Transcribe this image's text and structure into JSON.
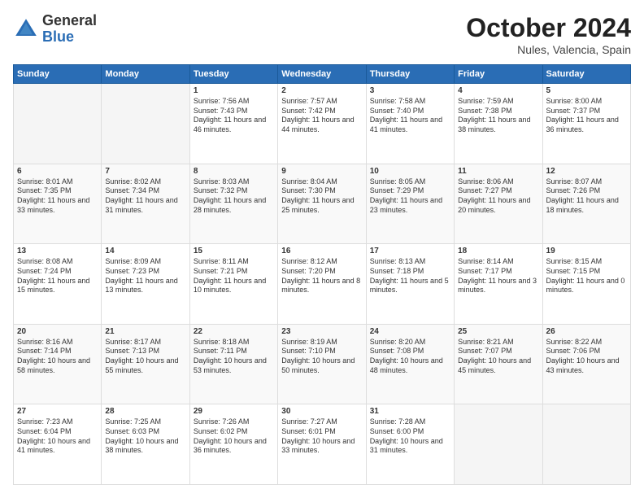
{
  "header": {
    "logo_general": "General",
    "logo_blue": "Blue",
    "month_year": "October 2024",
    "location": "Nules, Valencia, Spain"
  },
  "days_of_week": [
    "Sunday",
    "Monday",
    "Tuesday",
    "Wednesday",
    "Thursday",
    "Friday",
    "Saturday"
  ],
  "weeks": [
    [
      {
        "day": "",
        "sunrise": "",
        "sunset": "",
        "daylight": ""
      },
      {
        "day": "",
        "sunrise": "",
        "sunset": "",
        "daylight": ""
      },
      {
        "day": "1",
        "sunrise": "Sunrise: 7:56 AM",
        "sunset": "Sunset: 7:43 PM",
        "daylight": "Daylight: 11 hours and 46 minutes."
      },
      {
        "day": "2",
        "sunrise": "Sunrise: 7:57 AM",
        "sunset": "Sunset: 7:42 PM",
        "daylight": "Daylight: 11 hours and 44 minutes."
      },
      {
        "day": "3",
        "sunrise": "Sunrise: 7:58 AM",
        "sunset": "Sunset: 7:40 PM",
        "daylight": "Daylight: 11 hours and 41 minutes."
      },
      {
        "day": "4",
        "sunrise": "Sunrise: 7:59 AM",
        "sunset": "Sunset: 7:38 PM",
        "daylight": "Daylight: 11 hours and 38 minutes."
      },
      {
        "day": "5",
        "sunrise": "Sunrise: 8:00 AM",
        "sunset": "Sunset: 7:37 PM",
        "daylight": "Daylight: 11 hours and 36 minutes."
      }
    ],
    [
      {
        "day": "6",
        "sunrise": "Sunrise: 8:01 AM",
        "sunset": "Sunset: 7:35 PM",
        "daylight": "Daylight: 11 hours and 33 minutes."
      },
      {
        "day": "7",
        "sunrise": "Sunrise: 8:02 AM",
        "sunset": "Sunset: 7:34 PM",
        "daylight": "Daylight: 11 hours and 31 minutes."
      },
      {
        "day": "8",
        "sunrise": "Sunrise: 8:03 AM",
        "sunset": "Sunset: 7:32 PM",
        "daylight": "Daylight: 11 hours and 28 minutes."
      },
      {
        "day": "9",
        "sunrise": "Sunrise: 8:04 AM",
        "sunset": "Sunset: 7:30 PM",
        "daylight": "Daylight: 11 hours and 25 minutes."
      },
      {
        "day": "10",
        "sunrise": "Sunrise: 8:05 AM",
        "sunset": "Sunset: 7:29 PM",
        "daylight": "Daylight: 11 hours and 23 minutes."
      },
      {
        "day": "11",
        "sunrise": "Sunrise: 8:06 AM",
        "sunset": "Sunset: 7:27 PM",
        "daylight": "Daylight: 11 hours and 20 minutes."
      },
      {
        "day": "12",
        "sunrise": "Sunrise: 8:07 AM",
        "sunset": "Sunset: 7:26 PM",
        "daylight": "Daylight: 11 hours and 18 minutes."
      }
    ],
    [
      {
        "day": "13",
        "sunrise": "Sunrise: 8:08 AM",
        "sunset": "Sunset: 7:24 PM",
        "daylight": "Daylight: 11 hours and 15 minutes."
      },
      {
        "day": "14",
        "sunrise": "Sunrise: 8:09 AM",
        "sunset": "Sunset: 7:23 PM",
        "daylight": "Daylight: 11 hours and 13 minutes."
      },
      {
        "day": "15",
        "sunrise": "Sunrise: 8:11 AM",
        "sunset": "Sunset: 7:21 PM",
        "daylight": "Daylight: 11 hours and 10 minutes."
      },
      {
        "day": "16",
        "sunrise": "Sunrise: 8:12 AM",
        "sunset": "Sunset: 7:20 PM",
        "daylight": "Daylight: 11 hours and 8 minutes."
      },
      {
        "day": "17",
        "sunrise": "Sunrise: 8:13 AM",
        "sunset": "Sunset: 7:18 PM",
        "daylight": "Daylight: 11 hours and 5 minutes."
      },
      {
        "day": "18",
        "sunrise": "Sunrise: 8:14 AM",
        "sunset": "Sunset: 7:17 PM",
        "daylight": "Daylight: 11 hours and 3 minutes."
      },
      {
        "day": "19",
        "sunrise": "Sunrise: 8:15 AM",
        "sunset": "Sunset: 7:15 PM",
        "daylight": "Daylight: 11 hours and 0 minutes."
      }
    ],
    [
      {
        "day": "20",
        "sunrise": "Sunrise: 8:16 AM",
        "sunset": "Sunset: 7:14 PM",
        "daylight": "Daylight: 10 hours and 58 minutes."
      },
      {
        "day": "21",
        "sunrise": "Sunrise: 8:17 AM",
        "sunset": "Sunset: 7:13 PM",
        "daylight": "Daylight: 10 hours and 55 minutes."
      },
      {
        "day": "22",
        "sunrise": "Sunrise: 8:18 AM",
        "sunset": "Sunset: 7:11 PM",
        "daylight": "Daylight: 10 hours and 53 minutes."
      },
      {
        "day": "23",
        "sunrise": "Sunrise: 8:19 AM",
        "sunset": "Sunset: 7:10 PM",
        "daylight": "Daylight: 10 hours and 50 minutes."
      },
      {
        "day": "24",
        "sunrise": "Sunrise: 8:20 AM",
        "sunset": "Sunset: 7:08 PM",
        "daylight": "Daylight: 10 hours and 48 minutes."
      },
      {
        "day": "25",
        "sunrise": "Sunrise: 8:21 AM",
        "sunset": "Sunset: 7:07 PM",
        "daylight": "Daylight: 10 hours and 45 minutes."
      },
      {
        "day": "26",
        "sunrise": "Sunrise: 8:22 AM",
        "sunset": "Sunset: 7:06 PM",
        "daylight": "Daylight: 10 hours and 43 minutes."
      }
    ],
    [
      {
        "day": "27",
        "sunrise": "Sunrise: 7:23 AM",
        "sunset": "Sunset: 6:04 PM",
        "daylight": "Daylight: 10 hours and 41 minutes."
      },
      {
        "day": "28",
        "sunrise": "Sunrise: 7:25 AM",
        "sunset": "Sunset: 6:03 PM",
        "daylight": "Daylight: 10 hours and 38 minutes."
      },
      {
        "day": "29",
        "sunrise": "Sunrise: 7:26 AM",
        "sunset": "Sunset: 6:02 PM",
        "daylight": "Daylight: 10 hours and 36 minutes."
      },
      {
        "day": "30",
        "sunrise": "Sunrise: 7:27 AM",
        "sunset": "Sunset: 6:01 PM",
        "daylight": "Daylight: 10 hours and 33 minutes."
      },
      {
        "day": "31",
        "sunrise": "Sunrise: 7:28 AM",
        "sunset": "Sunset: 6:00 PM",
        "daylight": "Daylight: 10 hours and 31 minutes."
      },
      {
        "day": "",
        "sunrise": "",
        "sunset": "",
        "daylight": ""
      },
      {
        "day": "",
        "sunrise": "",
        "sunset": "",
        "daylight": ""
      }
    ]
  ]
}
